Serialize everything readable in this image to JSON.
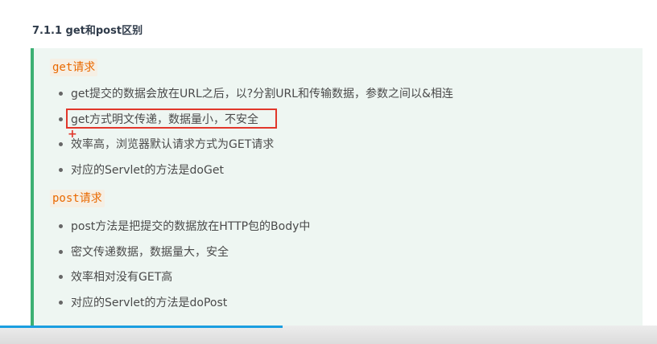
{
  "section_title": "7.1.1 get和post区别",
  "get": {
    "heading": "get请求",
    "items": [
      "get提交的数据会放在URL之后，以?分割URL和传输数据，参数之间以&相连",
      "get方式明文传递，数据量小，不安全",
      "效率高，浏览器默认请求方式为GET请求",
      "对应的Servlet的方法是doGet"
    ]
  },
  "post": {
    "heading": "post请求",
    "items": [
      "post方法是把提交的数据放在HTTP包的Body中",
      "密文传递数据，数据量大，安全",
      "效率相对没有GET高",
      "对应的Servlet的方法是doPost"
    ]
  },
  "colors": {
    "accent_border": "#3cb073",
    "callout_bg": "#eef6f2",
    "code_text": "#e96900",
    "highlight_box": "#e1372b",
    "progress": "#1a9ee0"
  },
  "video": {
    "progress_percent": 43
  }
}
